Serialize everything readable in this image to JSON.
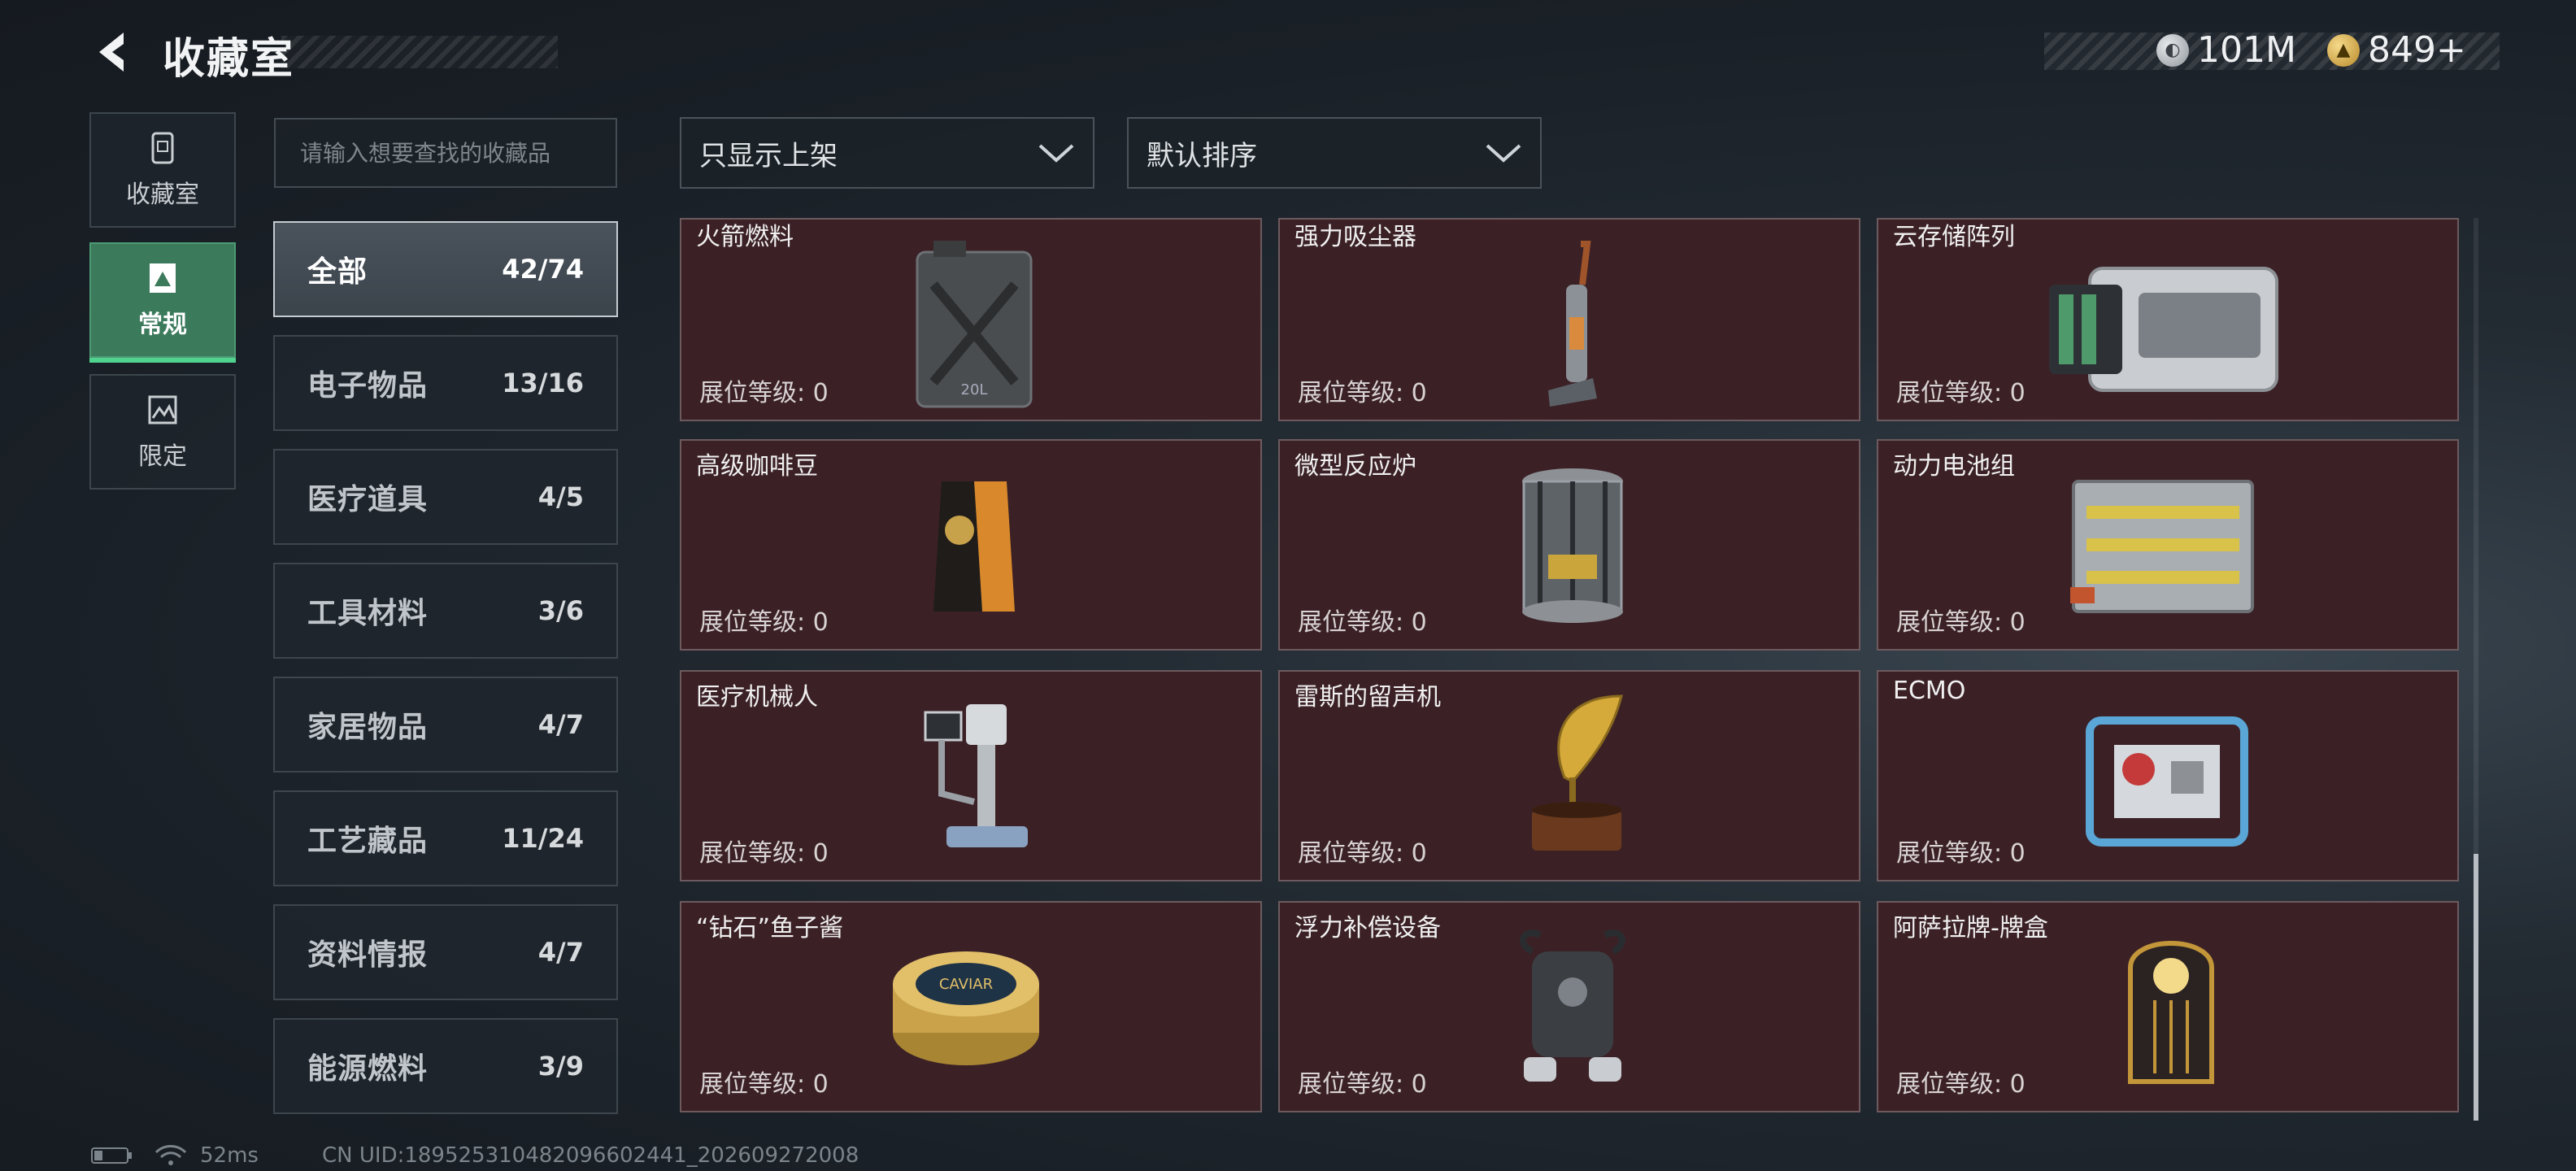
{
  "header": {
    "title": "收藏室",
    "currencies": [
      {
        "icon": "silver-coin-icon",
        "value": "101M"
      },
      {
        "icon": "gold-coin-icon",
        "value": "849+"
      }
    ]
  },
  "nav": {
    "tabs": [
      {
        "label": "收藏室",
        "icon": "collection-room-icon",
        "active": false
      },
      {
        "label": "常规",
        "icon": "regular-picture-icon",
        "active": true
      },
      {
        "label": "限定",
        "icon": "limited-picture-icon",
        "active": false
      }
    ]
  },
  "search": {
    "placeholder": "请输入想要查找的收藏品",
    "value": ""
  },
  "filters": {
    "display": {
      "selected": "只显示上架"
    },
    "sort": {
      "selected": "默认排序"
    }
  },
  "categories": [
    {
      "name": "全部",
      "count": "42/74",
      "active": true
    },
    {
      "name": "电子物品",
      "count": "13/16",
      "active": false
    },
    {
      "name": "医疗道具",
      "count": "4/5",
      "active": false
    },
    {
      "name": "工具材料",
      "count": "3/6",
      "active": false
    },
    {
      "name": "家居物品",
      "count": "4/7",
      "active": false
    },
    {
      "name": "工艺藏品",
      "count": "11/24",
      "active": false
    },
    {
      "name": "资料情报",
      "count": "4/7",
      "active": false
    },
    {
      "name": "能源燃料",
      "count": "3/9",
      "active": false
    }
  ],
  "items": [
    {
      "name": "火箭燃料",
      "level": "展位等级: 0",
      "art": "fuel-canister-icon"
    },
    {
      "name": "强力吸尘器",
      "level": "展位等级: 0",
      "art": "vacuum-cleaner-icon"
    },
    {
      "name": "云存储阵列",
      "level": "展位等级: 0",
      "art": "storage-array-icon"
    },
    {
      "name": "高级咖啡豆",
      "level": "展位等级: 0",
      "art": "coffee-bag-icon"
    },
    {
      "name": "微型反应炉",
      "level": "展位等级: 0",
      "art": "mini-reactor-icon"
    },
    {
      "name": "动力电池组",
      "level": "展位等级: 0",
      "art": "battery-pack-icon"
    },
    {
      "name": "医疗机械人",
      "level": "展位等级: 0",
      "art": "medical-robot-icon"
    },
    {
      "name": "雷斯的留声机",
      "level": "展位等级: 0",
      "art": "gramophone-icon"
    },
    {
      "name": "ECMO",
      "level": "展位等级: 0",
      "art": "ecmo-machine-icon"
    },
    {
      "name": "“钻石”鱼子酱",
      "level": "展位等级: 0",
      "art": "caviar-tin-icon"
    },
    {
      "name": "浮力补偿设备",
      "level": "展位等级: 0",
      "art": "buoyancy-device-icon"
    },
    {
      "name": "阿萨拉牌-牌盒",
      "level": "展位等级: 0",
      "art": "card-box-icon"
    }
  ],
  "status": {
    "ping": "52ms",
    "uid": "CN UID:18952531048209660244­1_202609272008"
  },
  "colors": {
    "card_bg": "#3b2126",
    "accent_green": "#4fd38e",
    "active_tab": "#3c7a5c"
  }
}
